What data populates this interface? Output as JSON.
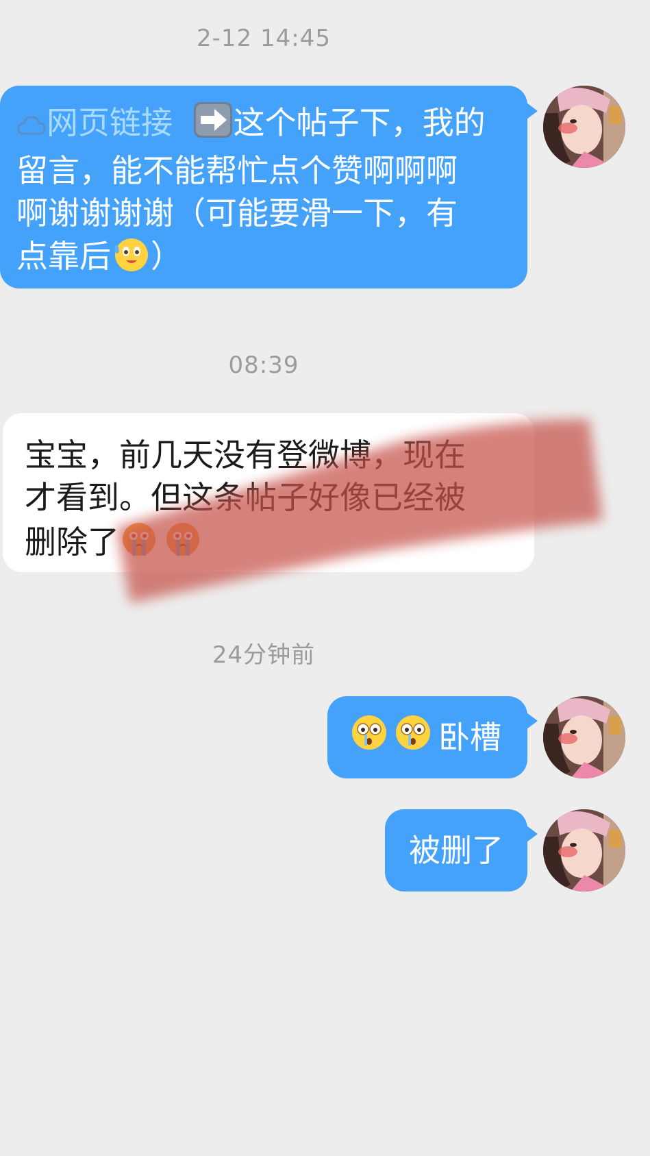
{
  "messages": [
    {
      "timestamp": "2-12 14:45",
      "direction": "out",
      "link_label": "网页链接",
      "arrow_emoji": "➡️",
      "text": "这个帖子下，我的留言，能不能帮忙点个赞啊啊啊啊谢谢谢谢（可能要滑一下，有点靠后",
      "emoji": "sweat-smile-emoji",
      "text_end": "）"
    },
    {
      "timestamp": "08:39",
      "direction": "in",
      "text": "宝宝，前几天没有登微博，现在才看到。但这条帖子好像已经被删除了",
      "emoji": "crying-emoji"
    },
    {
      "timestamp": "24分钟前",
      "direction": "out",
      "emoji": "flushed-emoji",
      "text": "卧槽"
    },
    {
      "direction": "out",
      "text": "被删了"
    }
  ],
  "colors": {
    "background": "#ededed",
    "outgoing_bubble": "#44a2fb",
    "incoming_bubble": "#ffffff",
    "link_text": "#a8dbff",
    "timestamp": "#9b9b9b"
  }
}
